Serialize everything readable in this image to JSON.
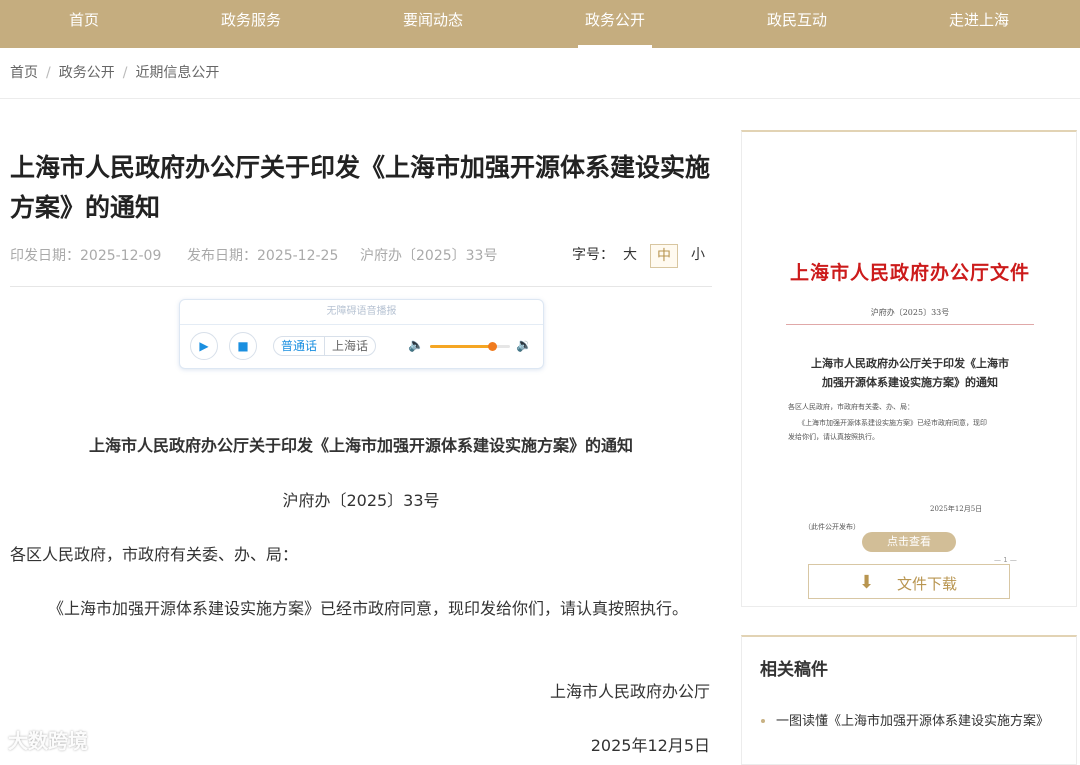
{
  "nav": {
    "items": [
      {
        "label": "首页"
      },
      {
        "label": "政务服务"
      },
      {
        "label": "要闻动态"
      },
      {
        "label": "政务公开"
      },
      {
        "label": "政民互动"
      },
      {
        "label": "走进上海"
      }
    ],
    "active": "政务公开"
  },
  "breadcrumb": [
    "首页",
    "政务公开",
    "近期信息公开"
  ],
  "article": {
    "title": "上海市人民政府办公厅关于印发《上海市加强开源体系建设实施方案》的通知",
    "issue_date": "印发日期：2025-12-09",
    "publish_date": "发布日期：2025-12-25",
    "doc_no": "沪府办〔2025〕33号",
    "font_size": {
      "label": "字号：",
      "large": "大",
      "medium": "中",
      "small": "小",
      "selected": "中"
    }
  },
  "player": {
    "title": "无障碍语音播报",
    "dialects": [
      "普通话",
      "上海话"
    ],
    "selected_dialect": "普通话",
    "volume": 0.78
  },
  "content": {
    "heading": "上海市人民政府办公厅关于印发《上海市加强开源体系建设实施方案》的通知",
    "doc_no": "沪府办〔2025〕33号",
    "addressee": "各区人民政府，市政府有关委、办、局：",
    "body": "《上海市加强开源体系建设实施方案》已经市政府同意，现印发给你们，请认真按照执行。",
    "signature": "上海市人民政府办公厅",
    "date": "2025年12月5日"
  },
  "preview": {
    "header": "上海市人民政府办公厅文件",
    "doc_no": "沪府办〔2025〕33号",
    "title_line1": "上海市人民政府办公厅关于印发《上海市",
    "title_line2": "加强开源体系建设实施方案》的通知",
    "addressee": "各区人民政府，市政府有关委、办、局：",
    "body_line1": "《上海市加强开源体系建设实施方案》已经市政府同意，现印",
    "body_line2": "发给你们，请认真按照执行。",
    "date": "2025年12月5日",
    "note": "（此件公开发布）",
    "view_button": "点击查看",
    "page": "— 1 —",
    "download_label": "文件下载"
  },
  "related": {
    "heading": "相关稿件",
    "items": [
      "一图读懂《上海市加强开源体系建设实施方案》"
    ]
  },
  "watermark": "大数跨境"
}
